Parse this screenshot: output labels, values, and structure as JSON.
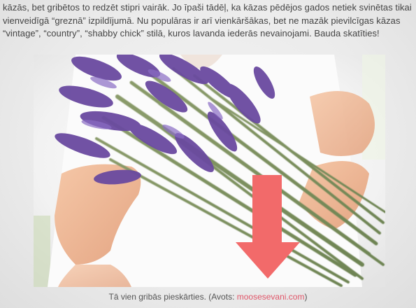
{
  "article": {
    "lines": [
      "kāzās, bet gribētos to redzēt stipri vairāk. Jo īpaši tādēļ, ka kāzas pēdējos gados netiek svinētas tikai",
      "vienveidīgā “greznā” izpildījumā. Nu populāras ir arī vienkāršākas, bet ne mazāk pievilcīgas kāzas",
      "“vintage”, “country”, “shabby chick” stilā, kuros lavanda iederās nevainojami. Bauda skatīties!"
    ]
  },
  "caption": {
    "text_before": "Tā vien gribās pieskārties. (Avots: ",
    "link_text": "moosesevani.com",
    "text_after": ")"
  },
  "colors": {
    "arrow": "#f26a6a",
    "link": "#e0576a",
    "lavender": "#6a4aa0"
  }
}
